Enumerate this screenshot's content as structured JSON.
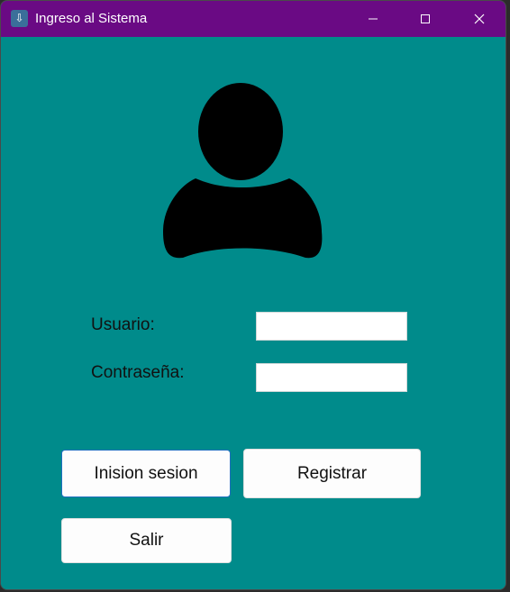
{
  "window": {
    "title": "Ingreso al Sistema",
    "app_icon": "download-arrow-icon",
    "controls": [
      "minimize-icon",
      "maximize-icon",
      "close-icon"
    ]
  },
  "form": {
    "avatar_icon": "user-icon",
    "username_label": "Usuario:",
    "username_value": "",
    "password_label": "Contraseña:",
    "password_value": ""
  },
  "buttons": {
    "login": "Inision sesion",
    "register": "Registrar",
    "exit": "Salir"
  },
  "colors": {
    "titlebar": "#6a0a84",
    "background": "#008b8b",
    "button": "#fdfdfd",
    "focus_border": "#1f6fbf"
  }
}
